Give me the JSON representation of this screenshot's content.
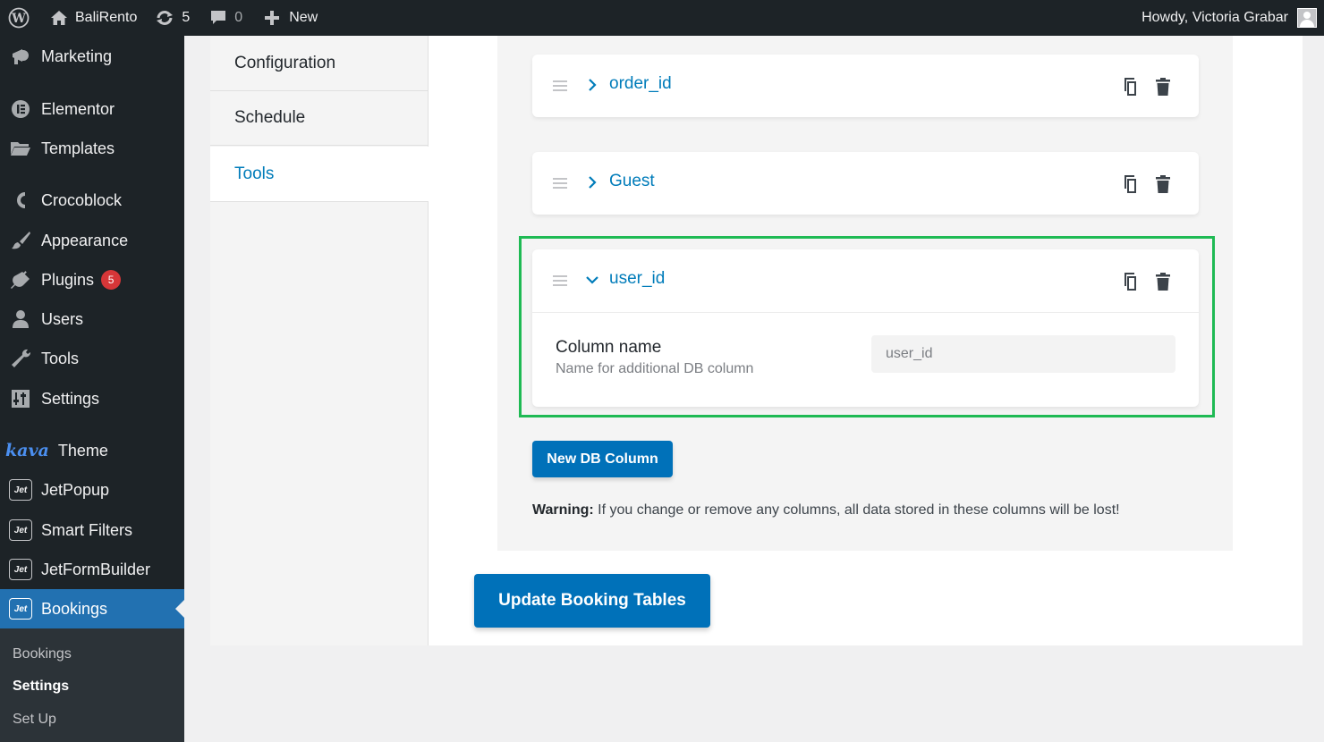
{
  "admin_bar": {
    "site_name": "BaliRento",
    "updates_count": "5",
    "comments_count": "0",
    "new_label": "New",
    "howdy": "Howdy, Victoria Grabar"
  },
  "sidebar": {
    "items": [
      {
        "label": "Marketing",
        "icon": "megaphone-icon"
      },
      {
        "label": "Elementor",
        "icon": "elementor-icon"
      },
      {
        "label": "Templates",
        "icon": "folder-icon"
      },
      {
        "label": "Crocoblock",
        "icon": "crocoblock-icon"
      },
      {
        "label": "Appearance",
        "icon": "paintbrush-icon"
      },
      {
        "label": "Plugins",
        "icon": "plugin-icon",
        "badge": "5"
      },
      {
        "label": "Users",
        "icon": "users-icon"
      },
      {
        "label": "Tools",
        "icon": "wrench-icon"
      },
      {
        "label": "Settings",
        "icon": "settings-icon"
      },
      {
        "label": "Theme",
        "icon": "kava-logo",
        "logo_text": "kava"
      },
      {
        "label": "JetPopup",
        "icon": "jet-icon",
        "logo_text": "Jet"
      },
      {
        "label": "Smart Filters",
        "icon": "jet-icon",
        "logo_text": "Jet"
      },
      {
        "label": "JetFormBuilder",
        "icon": "jet-icon",
        "logo_text": "Jet"
      },
      {
        "label": "Bookings",
        "icon": "jet-icon",
        "logo_text": "Jet"
      }
    ],
    "submenu": [
      {
        "label": "Bookings"
      },
      {
        "label": "Settings"
      },
      {
        "label": "Set Up"
      }
    ]
  },
  "tabs": [
    {
      "label": "Configuration"
    },
    {
      "label": "Schedule"
    },
    {
      "label": "Tools"
    }
  ],
  "columns": [
    {
      "title": "order_id",
      "expanded": false
    },
    {
      "title": "Guest",
      "expanded": false
    },
    {
      "title": "user_id",
      "expanded": true
    }
  ],
  "column_field": {
    "label": "Column name",
    "description": "Name for additional DB column",
    "value": "user_id"
  },
  "buttons": {
    "new_column": "New DB Column",
    "update": "Update Booking Tables"
  },
  "warning": {
    "prefix": "Warning:",
    "text": " If you change or remove any columns, all data stored in these columns will be lost!"
  },
  "colors": {
    "accent": "#007cba",
    "admin_dark": "#1d2327",
    "highlight": "#1fba54",
    "badge": "#d63638"
  }
}
